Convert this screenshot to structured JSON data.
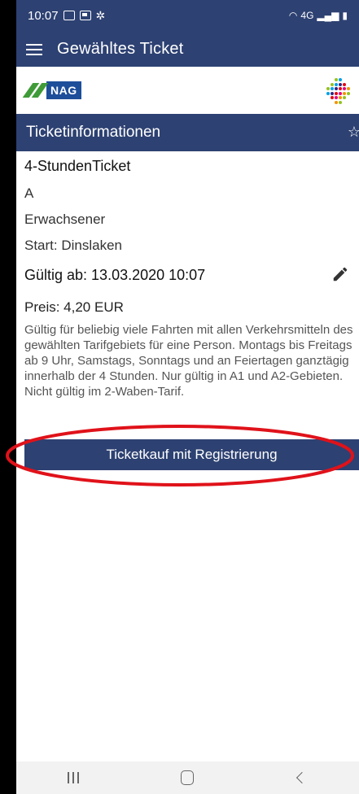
{
  "status_bar": {
    "time": "10:07",
    "network": "4G"
  },
  "app_bar": {
    "title": "Gewähltes Ticket"
  },
  "brand": {
    "operator": "NAG"
  },
  "section": {
    "title": "Ticketinformationen"
  },
  "ticket": {
    "name": "4-StundenTicket",
    "zone": "A",
    "passenger": "Erwachsener",
    "start": "Start: Dinslaken",
    "valid_from": "Gültig ab: 13.03.2020 10:07",
    "price": "Preis: 4,20 EUR",
    "description": "Gültig für beliebig viele Fahrten mit allen Verkehrsmitteln des gewählten Tarifgebiets für eine Person. Montags bis Freitags ab 9 Uhr, Samstags, Sonntags und an Feiertagen ganztägig innerhalb der 4 Stunden. Nur gültig in A1 und A2-Gebieten. Nicht gültig im 2-Waben-Tarif."
  },
  "actions": {
    "buy_label": "Ticketkauf mit Registrierung"
  },
  "colors": {
    "primary": "#2d4172",
    "highlight": "#e0121a",
    "brand_green": "#3f9b38",
    "brand_blue": "#1d4e9a"
  }
}
